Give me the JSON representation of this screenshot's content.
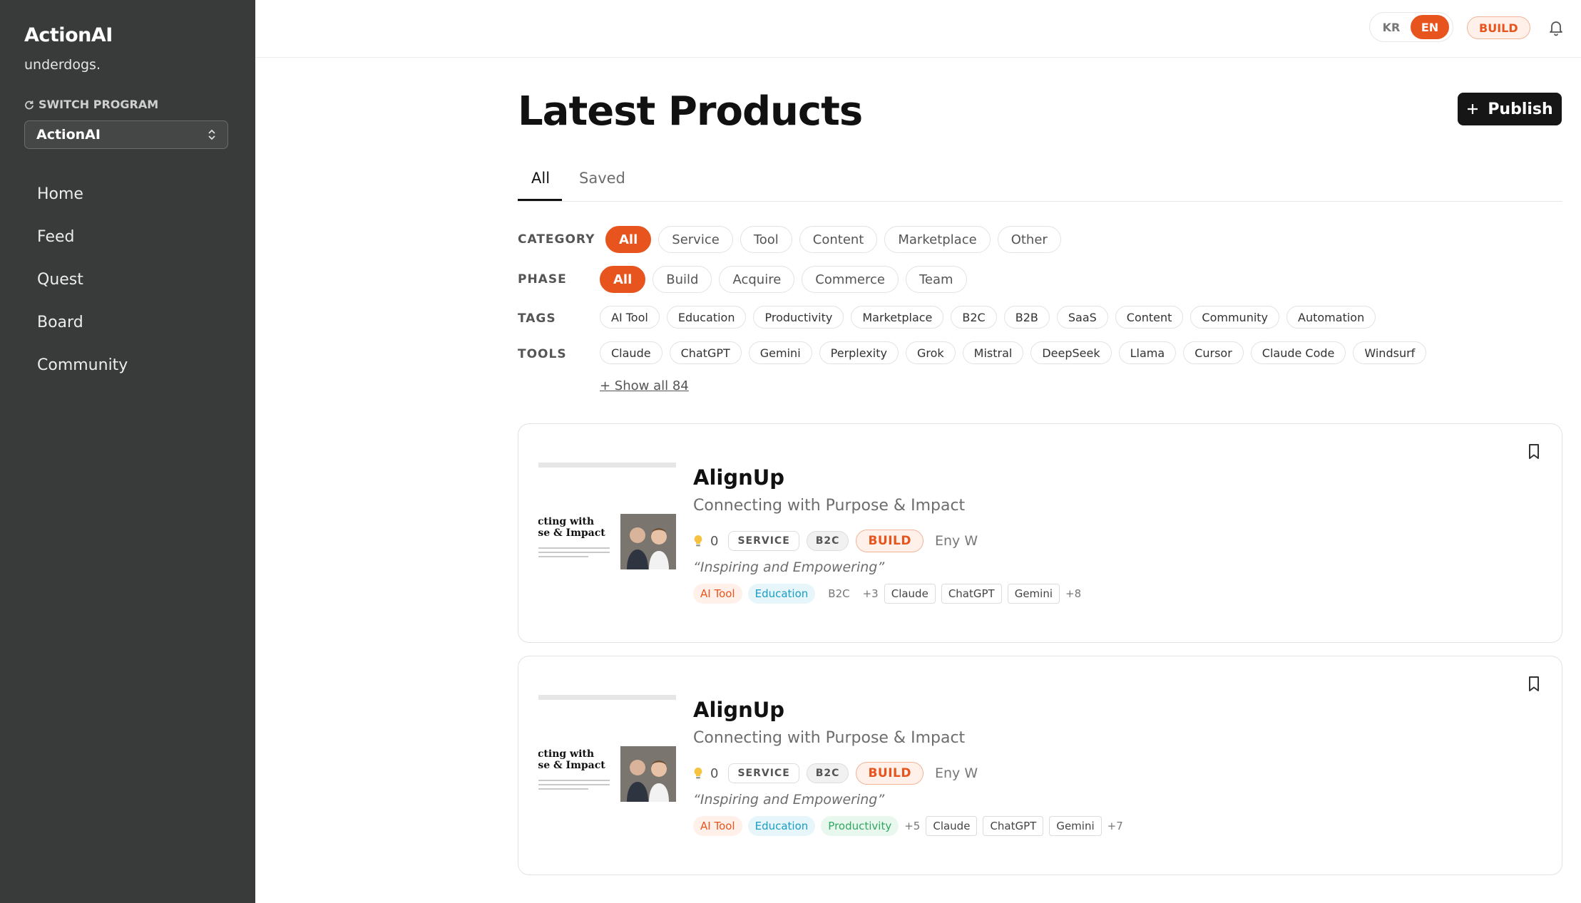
{
  "sidebar": {
    "brand": "ActionAI",
    "tagline": "underdogs.",
    "switch_label": "SWITCH PROGRAM",
    "program_selected": "ActionAI",
    "nav": [
      "Home",
      "Feed",
      "Quest",
      "Board",
      "Community"
    ]
  },
  "header": {
    "lang": [
      "KR",
      "EN"
    ],
    "lang_active": "EN",
    "badge": "BUILD"
  },
  "main": {
    "title": "Latest Products",
    "publish_label": "Publish",
    "tabs": [
      "All",
      "Saved"
    ],
    "filters": {
      "category_label": "CATEGORY",
      "category": [
        "All",
        "Service",
        "Tool",
        "Content",
        "Marketplace",
        "Other"
      ],
      "phase_label": "PHASE",
      "phase": [
        "All",
        "Build",
        "Acquire",
        "Commerce",
        "Team"
      ],
      "tags_label": "TAGS",
      "tags": [
        "AI Tool",
        "Education",
        "Productivity",
        "Marketplace",
        "B2C",
        "B2B",
        "SaaS",
        "Content",
        "Community",
        "Automation"
      ],
      "tools_label": "TOOLS",
      "tools": [
        "Claude",
        "ChatGPT",
        "Gemini",
        "Perplexity",
        "Grok",
        "Mistral",
        "DeepSeek",
        "Llama",
        "Cursor",
        "Claude Code",
        "Windsurf"
      ],
      "show_all": "+ Show all 84"
    },
    "products": [
      {
        "title": "AlignUp",
        "subtitle": "Connecting with Purpose & Impact",
        "likes": "0",
        "category": "SERVICE",
        "market": "B2C",
        "phase": "BUILD",
        "author": "Eny W",
        "quote": "“Inspiring and Empowering”",
        "thumb_line1": "ecting with",
        "thumb_line2": "ose & Impact",
        "tags": [
          {
            "label": "AI Tool",
            "style": "t-orange"
          },
          {
            "label": "Education",
            "style": "t-blue"
          },
          {
            "label": "B2C",
            "style": "t-plain"
          }
        ],
        "tags_more": "+3",
        "tools": [
          "Claude",
          "ChatGPT",
          "Gemini"
        ],
        "tools_more": "+8"
      },
      {
        "title": "AlignUp",
        "subtitle": "Connecting with Purpose & Impact",
        "likes": "0",
        "category": "SERVICE",
        "market": "B2C",
        "phase": "BUILD",
        "author": "Eny W",
        "quote": "“Inspiring and Empowering”",
        "thumb_line1": "ecting with",
        "thumb_line2": "ose & Impact",
        "tags": [
          {
            "label": "AI Tool",
            "style": "t-orange"
          },
          {
            "label": "Education",
            "style": "t-blue"
          },
          {
            "label": "Productivity",
            "style": "t-green"
          }
        ],
        "tags_more": "+5",
        "tools": [
          "Claude",
          "ChatGPT",
          "Gemini"
        ],
        "tools_more": "+7"
      }
    ]
  },
  "colors": {
    "accent": "#e8541e",
    "sidebar_bg": "#393b3a",
    "publish_bg": "#161616"
  }
}
